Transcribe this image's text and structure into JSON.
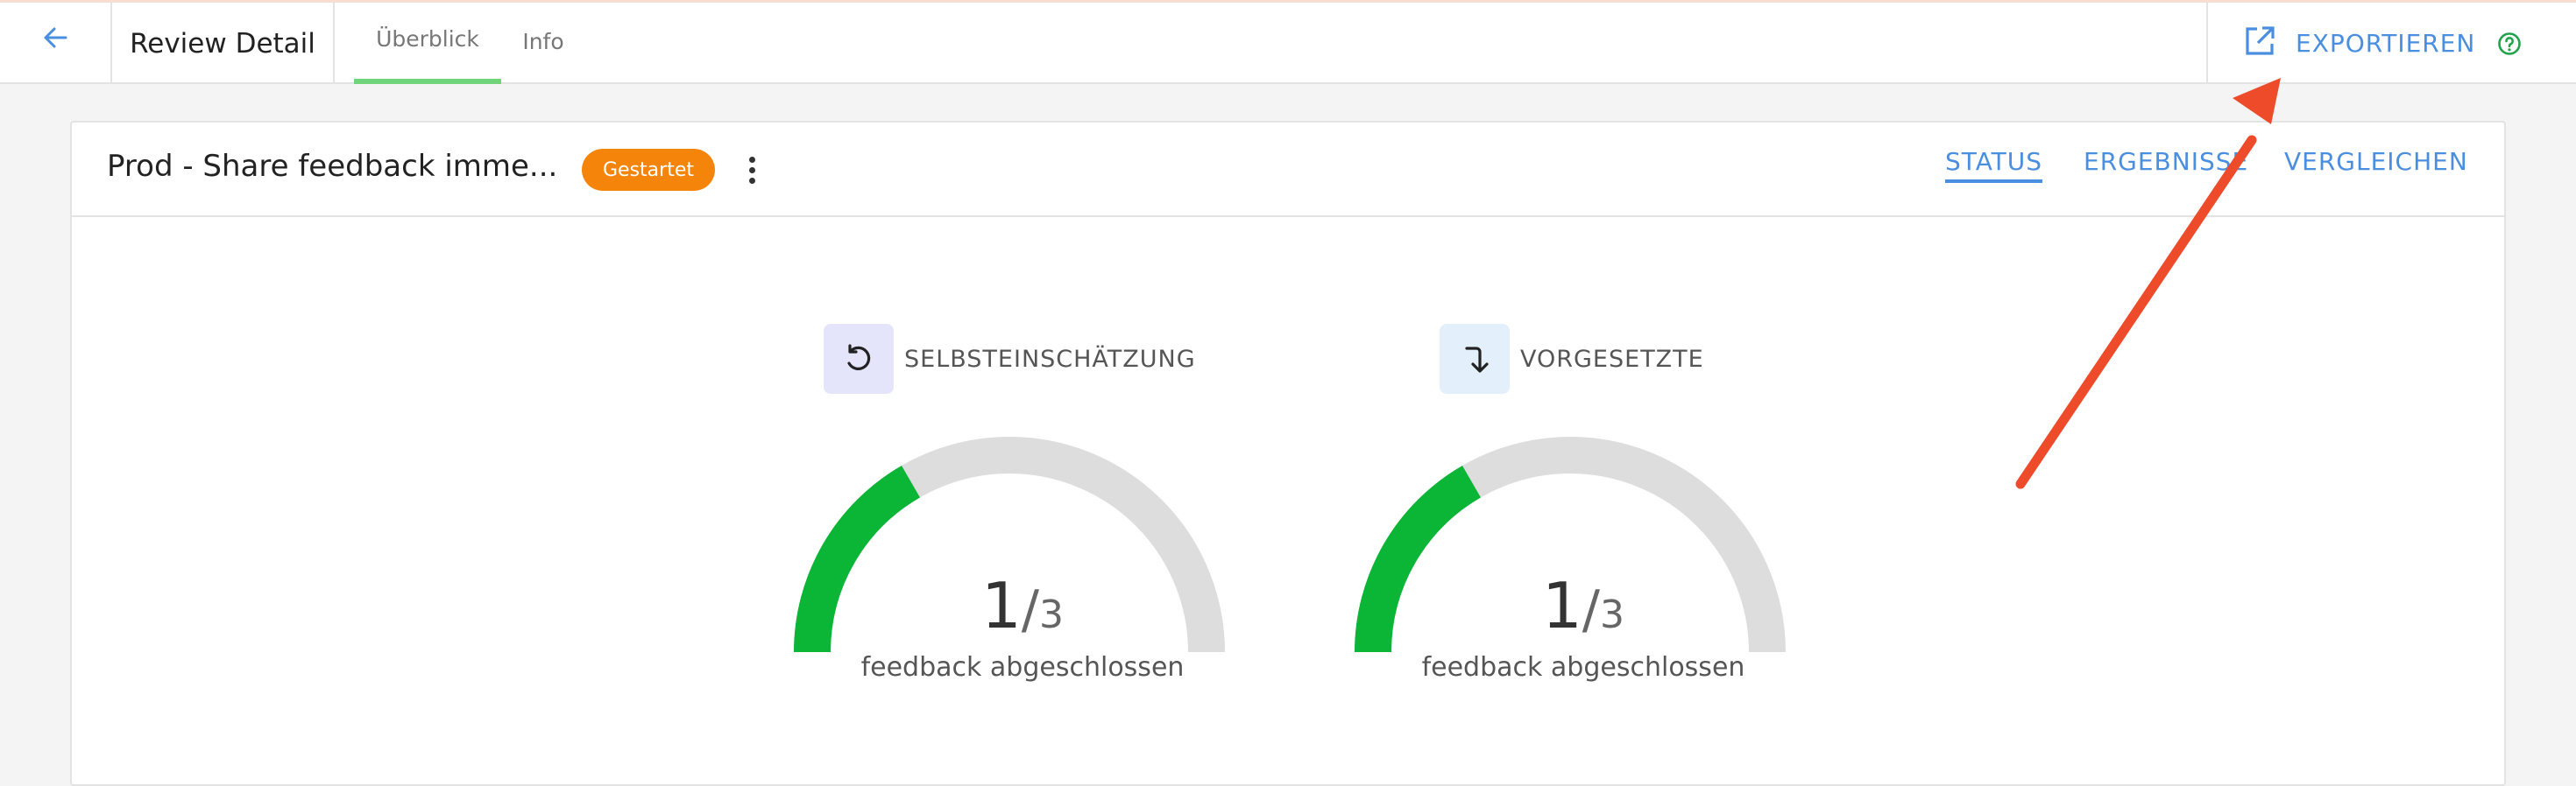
{
  "header": {
    "back_icon": "arrow-left-icon",
    "title": "Review Detail",
    "tabs": [
      {
        "label": "Überblick",
        "active": true
      },
      {
        "label": "Info",
        "active": false
      }
    ],
    "export": {
      "icon": "external-link-icon",
      "label": "EXPORTIEREN",
      "help_icon": "help-circle-icon"
    }
  },
  "review": {
    "title": "Prod - Share feedback imme...",
    "status": "Gestartet",
    "menu_icon": "more-vertical-icon",
    "tabs": [
      {
        "label": "STATUS",
        "active": true
      },
      {
        "label": "ERGEBNISSE",
        "active": false
      },
      {
        "label": "VERGLEICHEN",
        "active": false
      }
    ]
  },
  "gauges": [
    {
      "label": "SELBSTEINSCHÄTZUNG",
      "icon": "rotate-ccw-icon",
      "completed": "1",
      "separator": "/",
      "total": "3",
      "caption": "feedback abgeschlossen"
    },
    {
      "label": "VORGESETZTE",
      "icon": "arrow-down-corner-icon",
      "completed": "1",
      "separator": "/",
      "total": "3",
      "caption": "feedback abgeschlossen"
    }
  ],
  "colors": {
    "accent": "#4a8fdf",
    "tab_indicator": "#6fd47a",
    "badge": "#f5850a",
    "gauge_fill": "#0bb536",
    "gauge_track": "#dddddd",
    "annotation": "#ee4b2b",
    "help": "#1fa34a"
  }
}
